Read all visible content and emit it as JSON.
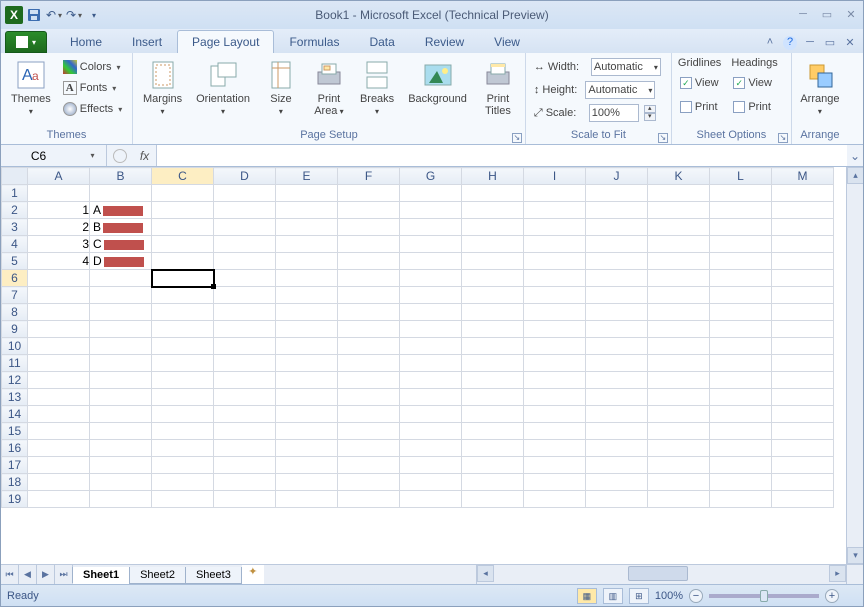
{
  "title": "Book1  -  Microsoft Excel (Technical Preview)",
  "qat": {
    "excel": "X",
    "save": "💾",
    "undo": "↶",
    "redo": "↷"
  },
  "tabs": {
    "file": "File",
    "items": [
      "Home",
      "Insert",
      "Page Layout",
      "Formulas",
      "Data",
      "Review",
      "View"
    ],
    "active": 2
  },
  "ribbon": {
    "themes": {
      "label": "Themes",
      "themes_btn": "Themes",
      "colors": "Colors",
      "fonts": "Fonts",
      "effects": "Effects"
    },
    "pagesetup": {
      "label": "Page Setup",
      "margins": "Margins",
      "orientation": "Orientation",
      "size": "Size",
      "printarea": "Print\nArea",
      "breaks": "Breaks",
      "background": "Background",
      "titles": "Print\nTitles"
    },
    "scale": {
      "label": "Scale to Fit",
      "width": "Width:",
      "height": "Height:",
      "scale": "Scale:",
      "width_val": "Automatic",
      "height_val": "Automatic",
      "scale_val": "100%"
    },
    "sheetopt": {
      "label": "Sheet Options",
      "gridlines": "Gridlines",
      "headings": "Headings",
      "view": "View",
      "print": "Print",
      "g_view": true,
      "g_print": false,
      "h_view": true,
      "h_print": false
    },
    "arrange": {
      "label": "Arrange",
      "btn": "Arrange"
    }
  },
  "namebox": "C6",
  "fx": "fx",
  "columns": [
    "A",
    "B",
    "C",
    "D",
    "E",
    "F",
    "G",
    "H",
    "I",
    "J",
    "K",
    "L",
    "M"
  ],
  "rows": [
    1,
    2,
    3,
    4,
    5,
    6,
    7,
    8,
    9,
    10,
    11,
    12,
    13,
    14,
    15,
    16,
    17,
    18,
    19
  ],
  "cells": {
    "A2": "1",
    "A3": "2",
    "A4": "3",
    "A5": "4",
    "B2": "A",
    "B3": "B",
    "B4": "C",
    "B5": "D"
  },
  "bar_cells": [
    "B2",
    "B3",
    "B4",
    "B5"
  ],
  "active_cell": "C6",
  "active_col": "C",
  "active_row": 6,
  "page_break_col": "I",
  "sheet_tabs": [
    "Sheet1",
    "Sheet2",
    "Sheet3"
  ],
  "active_sheet": 0,
  "status": {
    "ready": "Ready",
    "zoom": "100%"
  },
  "chart_data": {
    "type": "bar",
    "categories": [
      "A",
      "B",
      "C",
      "D"
    ],
    "values": [
      1,
      2,
      3,
      4
    ],
    "title": "",
    "xlabel": "",
    "ylabel": "",
    "ylim": [
      0,
      4
    ]
  }
}
